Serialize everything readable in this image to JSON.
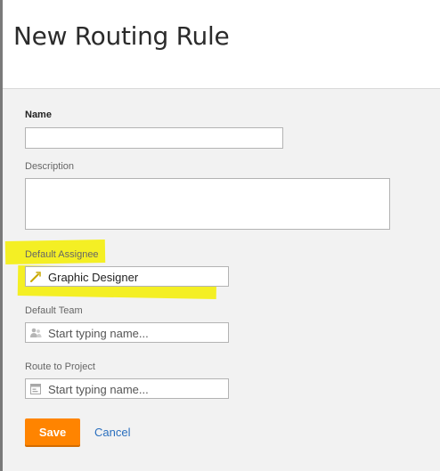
{
  "page": {
    "title": "New Routing Rule"
  },
  "form": {
    "name": {
      "label": "Name",
      "value": ""
    },
    "description": {
      "label": "Description",
      "value": ""
    },
    "default_assignee": {
      "label": "Default Assignee",
      "value": "Graphic Designer",
      "icon": "role-icon"
    },
    "default_team": {
      "label": "Default Team",
      "placeholder": "Start typing name...",
      "icon": "team-icon"
    },
    "route_to_project": {
      "label": "Route to Project",
      "placeholder": "Start typing name...",
      "icon": "project-icon"
    }
  },
  "actions": {
    "save_label": "Save",
    "cancel_label": "Cancel"
  },
  "colors": {
    "highlight": "#f4ef00",
    "primary_button": "#ff8400",
    "link": "#2a6fbe"
  }
}
